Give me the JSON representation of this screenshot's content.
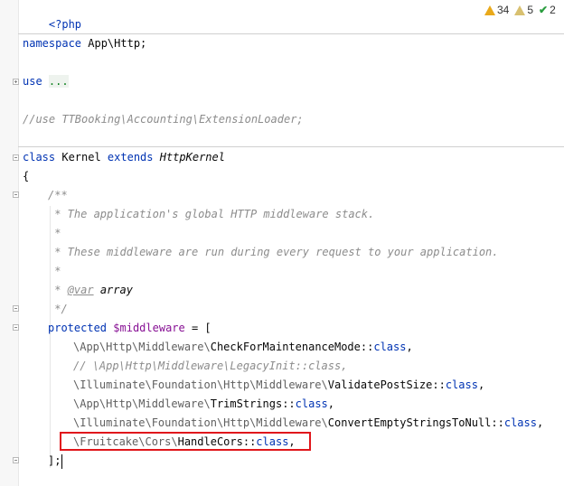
{
  "inspections": {
    "warnings": "34",
    "weak_warnings": "5",
    "ok": "2",
    "warn_icon": "warning-icon",
    "weak_icon": "weak-warning-icon",
    "ok_icon": "check-icon"
  },
  "code": {
    "l1": "<?php",
    "l2_kw": "namespace",
    "l2_rest": " App\\Http;",
    "l3_kw": "use",
    "l3_dots": "...",
    "l4": "//use TTBooking\\Accounting\\ExtensionLoader;",
    "l5_kw1": "class",
    "l5_name": " Kernel ",
    "l5_kw2": "extends",
    "l5_parent": "HttpKernel",
    "l6": "{",
    "l7": "/**",
    "l8": " * The application's global HTTP middleware stack.",
    "l9": " *",
    "l10": " * These middleware are run during every request to your application.",
    "l11": " *",
    "l12_pre": " * ",
    "l12_tag": "@var",
    "l12_type": "array",
    "l13": " */",
    "l14_kw": "protected",
    "l14_var": "$middleware",
    "l14_rest": " = [",
    "m1_ns": "\\App\\Http\\Middleware\\",
    "m1_cls": "CheckForMaintenanceMode",
    "m2": "// \\App\\Http\\Middleware\\LegacyInit::class,",
    "m3_ns": "\\Illuminate\\Foundation\\Http\\Middleware\\",
    "m3_cls": "ValidatePostSize",
    "m4_ns": "\\App\\Http\\Middleware\\",
    "m4_cls": "TrimStrings",
    "m5_ns": "\\Illuminate\\Foundation\\Http\\Middleware\\",
    "m5_cls": "ConvertEmptyStringsToNull",
    "m6_ns": "\\Fruitcake\\Cors\\",
    "m6_cls": "HandleCors",
    "class_suffix": "::",
    "class_kw": "class",
    "comma": ",",
    "close": "];"
  }
}
